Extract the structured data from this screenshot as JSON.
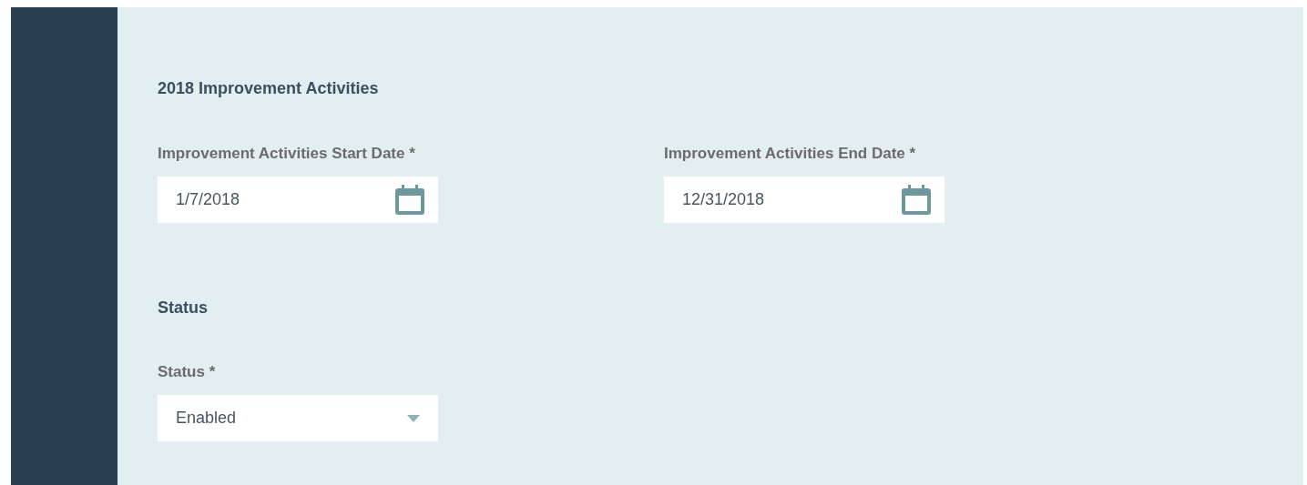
{
  "sections": [
    {
      "title": "2018 Improvement Activities",
      "fields": [
        {
          "kind": "date",
          "label": "Improvement Activities Start Date *",
          "value": "1/7/2018"
        },
        {
          "kind": "date",
          "label": "Improvement Activities End Date *",
          "value": "12/31/2018"
        }
      ]
    },
    {
      "title": "Status",
      "fields": [
        {
          "kind": "select",
          "label": "Status *",
          "value": "Enabled"
        }
      ]
    }
  ]
}
